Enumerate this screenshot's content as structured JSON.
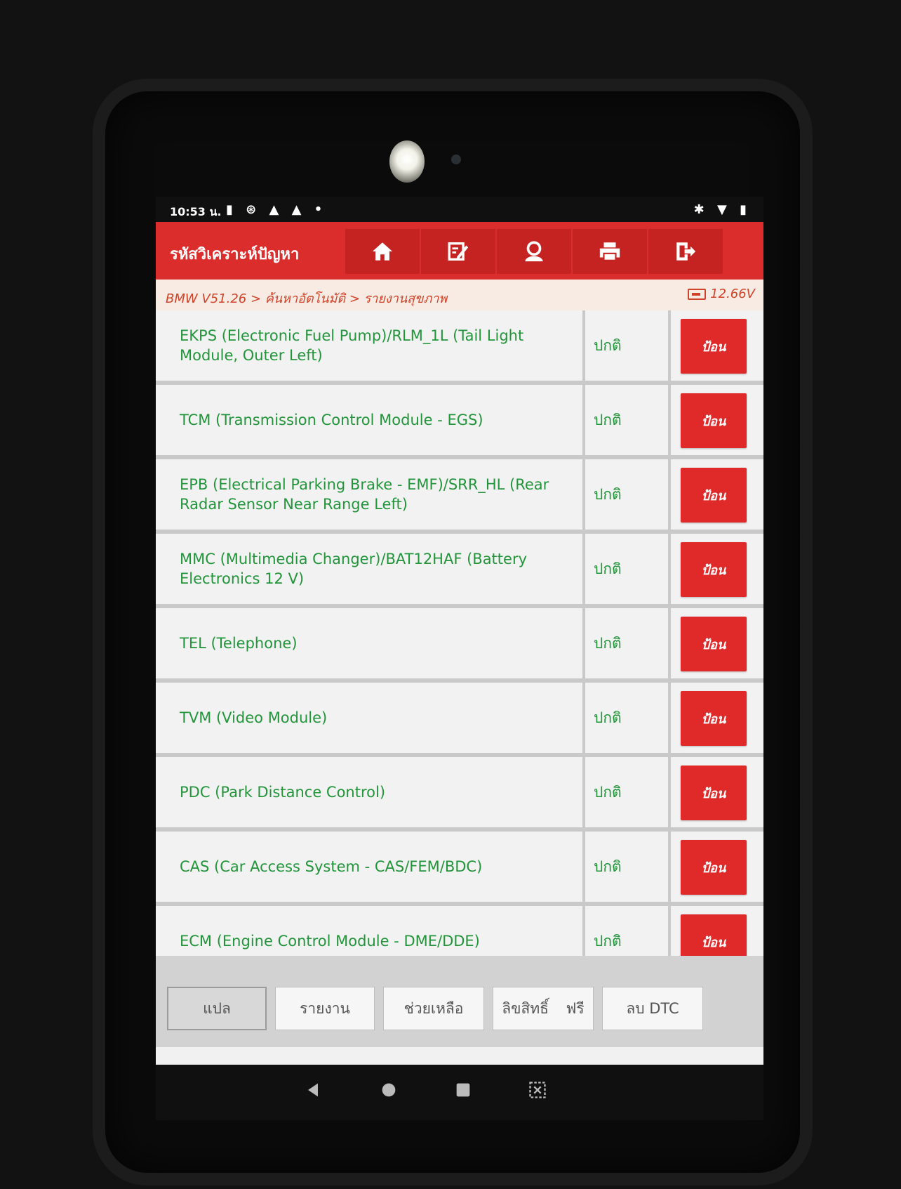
{
  "status_bar": {
    "time": "10:53 น."
  },
  "header": {
    "title": "รหัสวิเคราะห์ปัญหา",
    "tools": [
      {
        "icon": "home-icon"
      },
      {
        "icon": "edit-report-icon"
      },
      {
        "icon": "user-icon"
      },
      {
        "icon": "print-icon"
      },
      {
        "icon": "exit-icon"
      }
    ]
  },
  "breadcrumb": {
    "path": "BMW V51.26 > ค้นหาอัตโนมัติ > รายงานสุขภาพ",
    "voltage": "12.66V"
  },
  "modules": [
    {
      "name": "EKPS (Electronic Fuel Pump)/RLM_1L (Tail Light Module, Outer Left)",
      "status": "ปกติ",
      "action": "ป้อน"
    },
    {
      "name": "TCM (Transmission Control Module - EGS)",
      "status": "ปกติ",
      "action": "ป้อน"
    },
    {
      "name": "EPB (Electrical Parking Brake - EMF)/SRR_HL (Rear Radar Sensor Near Range Left)",
      "status": "ปกติ",
      "action": "ป้อน"
    },
    {
      "name": "MMC (Multimedia Changer)/BAT12HAF (Battery Electronics 12 V)",
      "status": "ปกติ",
      "action": "ป้อน"
    },
    {
      "name": "TEL (Telephone)",
      "status": "ปกติ",
      "action": "ป้อน"
    },
    {
      "name": "TVM (Video Module)",
      "status": "ปกติ",
      "action": "ป้อน"
    },
    {
      "name": "PDC (Park Distance Control)",
      "status": "ปกติ",
      "action": "ป้อน"
    },
    {
      "name": "CAS (Car Access System - CAS/FEM/BDC)",
      "status": "ปกติ",
      "action": "ป้อน"
    },
    {
      "name": "ECM (Engine Control Module - DME/DDE)",
      "status": "ปกติ",
      "action": "ป้อน"
    }
  ],
  "bottom_buttons": {
    "translate": "แปล",
    "report": "รายงาน",
    "help": "ช่วยเหลือ",
    "copyright_a": "ลิขสิทธิ์",
    "copyright_b": "ฟรี",
    "clear_dtc": "ลบ DTC"
  }
}
